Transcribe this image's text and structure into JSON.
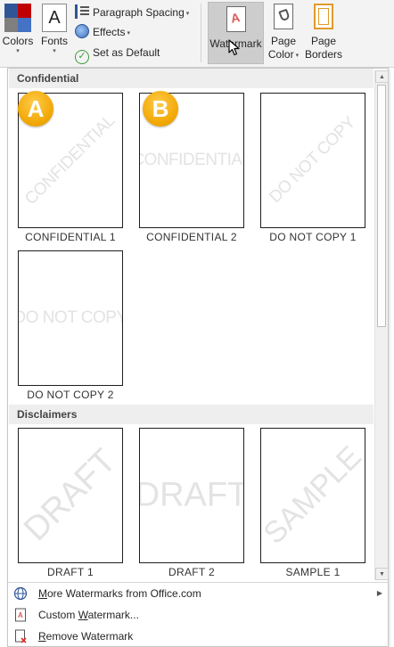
{
  "ribbon": {
    "colors_label": "Colors",
    "fonts_label": "Fonts",
    "fonts_glyph": "A",
    "paragraph_spacing_label": "Paragraph Spacing",
    "effects_label": "Effects",
    "set_as_default_label": "Set as Default",
    "watermark_label": "Watermark",
    "page_color_line1": "Page",
    "page_color_line2": "Color",
    "page_borders_line1": "Page",
    "page_borders_line2": "Borders",
    "dropdown_caret": "▾"
  },
  "gallery": {
    "sections": [
      {
        "title": "Confidential",
        "items": [
          {
            "label": "CONFIDENTIAL 1",
            "text": "CONFIDENTIAL",
            "orientation": "diagonal"
          },
          {
            "label": "CONFIDENTIAL 2",
            "text": "CONFIDENTIAL",
            "orientation": "horizontal"
          },
          {
            "label": "DO NOT COPY 1",
            "text": "DO NOT COPY",
            "orientation": "diagonal"
          },
          {
            "label": "DO NOT COPY 2",
            "text": "DO NOT COPY",
            "orientation": "horizontal"
          }
        ]
      },
      {
        "title": "Disclaimers",
        "items": [
          {
            "label": "DRAFT 1",
            "text": "DRAFT",
            "orientation": "diagonal"
          },
          {
            "label": "DRAFT 2",
            "text": "DRAFT",
            "orientation": "horizontal"
          },
          {
            "label": "SAMPLE 1",
            "text": "SAMPLE",
            "orientation": "diagonal"
          }
        ]
      }
    ],
    "callouts": [
      "A",
      "B"
    ]
  },
  "menu": {
    "more_watermarks": {
      "prefix": "M",
      "rest": "ore Watermarks from Office.com"
    },
    "custom_watermark": {
      "before": "Custom ",
      "accel": "W",
      "after": "atermark..."
    },
    "remove_watermark": {
      "prefix": "R",
      "rest": "emove Watermark"
    }
  },
  "icons": {
    "colors": "theme-colors-icon",
    "fonts": "theme-fonts-icon",
    "paragraph_spacing": "paragraph-spacing-icon",
    "effects": "effects-icon",
    "set_default": "checkmark-circle-icon",
    "watermark": "watermark-page-icon",
    "page_color": "paint-bucket-page-icon",
    "page_borders": "page-border-icon",
    "more": "globe-icon",
    "custom": "custom-watermark-page-icon",
    "remove": "remove-watermark-page-icon"
  },
  "colors": {
    "badge": "#f0a500",
    "ribbon_bg": "#f3f3f3",
    "selected_button": "#cdcdcd",
    "section_header_bg": "#eeeeee",
    "watermark_text": "#e3e3e3"
  }
}
